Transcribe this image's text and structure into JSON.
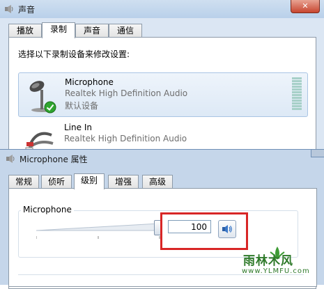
{
  "sound_window": {
    "title": "声音",
    "tabs": [
      "播放",
      "录制",
      "声音",
      "通信"
    ],
    "active_tab": "录制",
    "instruction": "选择以下录制设备来修改设置:",
    "devices": [
      {
        "name": "Microphone",
        "driver": "Realtek High Definition Audio",
        "status": "默认设备",
        "icon": "microphone-icon",
        "default": true
      },
      {
        "name": "Line In",
        "driver": "Realtek High Definition Audio",
        "icon": "line-in-cable-icon"
      }
    ]
  },
  "properties_dialog": {
    "title": "Microphone 属性",
    "tabs": [
      "常规",
      "侦听",
      "级别",
      "增强",
      "高级"
    ],
    "active_tab": "级别",
    "levels": {
      "group_label": "Microphone",
      "value": "100",
      "slider_fraction": 1.0,
      "mute_icon": "speaker-icon"
    }
  },
  "watermark": {
    "text": "雨林木风",
    "url": "www.YLMFU.com"
  },
  "colors": {
    "highlight": "#d82626",
    "default_check": "#2fa52f",
    "watermark": "#2f7a2a"
  }
}
